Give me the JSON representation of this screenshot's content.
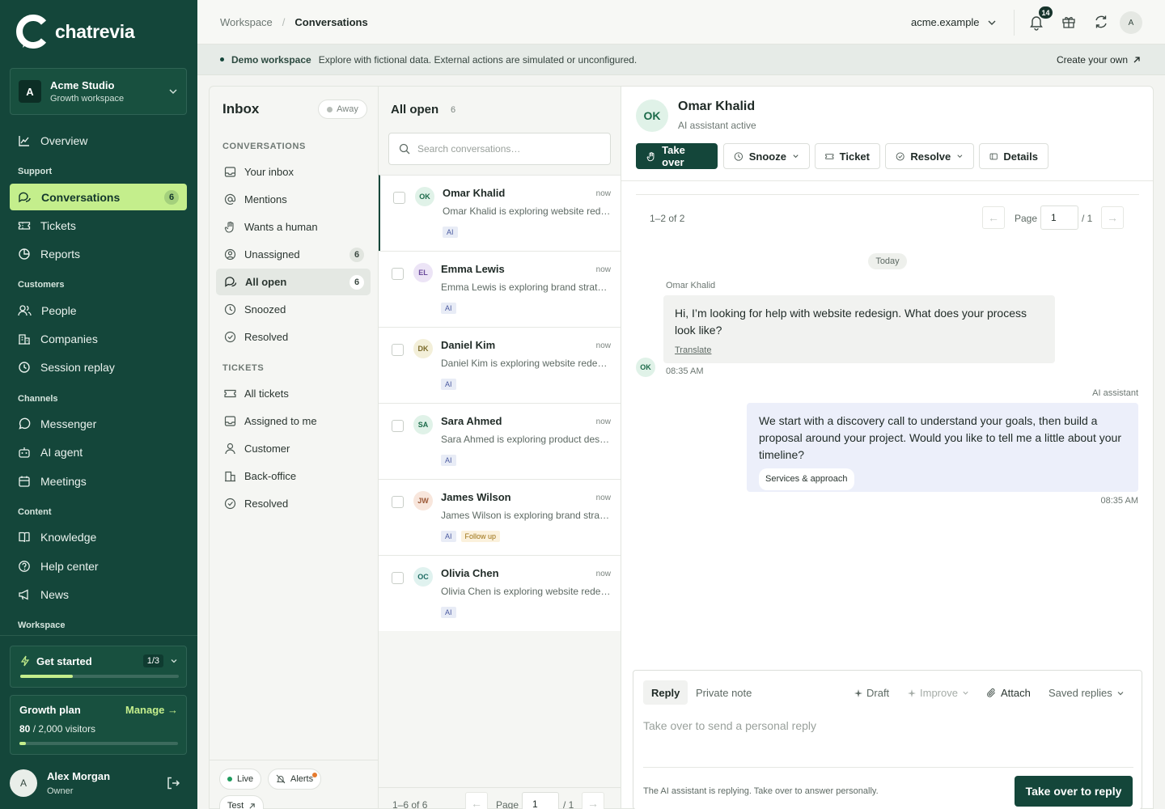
{
  "brand": {
    "name": "chatrevia"
  },
  "workspace": {
    "name": "Acme Studio",
    "plan": "Growth workspace",
    "initial": "A"
  },
  "nav": {
    "overview": "Overview",
    "sec_support": "Support",
    "conversations": "Conversations",
    "conversations_badge": "6",
    "tickets": "Tickets",
    "reports": "Reports",
    "sec_customers": "Customers",
    "people": "People",
    "companies": "Companies",
    "session_replay": "Session replay",
    "sec_channels": "Channels",
    "messenger": "Messenger",
    "ai_agent": "AI agent",
    "meetings": "Meetings",
    "sec_content": "Content",
    "knowledge": "Knowledge",
    "help_center": "Help center",
    "news": "News",
    "sec_workspace": "Workspace"
  },
  "get_started": {
    "label": "Get started",
    "count": "1/3",
    "progress": 0.33
  },
  "growth_plan": {
    "label": "Growth plan",
    "manage": "Manage →",
    "used": "80",
    "limit": " / 2,000 visitors",
    "progress": 0.04
  },
  "user": {
    "name": "Alex Morgan",
    "role": "Owner",
    "initial": "A"
  },
  "topbar": {
    "crumb_root": "Workspace",
    "crumb_sep": "/",
    "crumb_current": "Conversations",
    "domain": "acme.example",
    "notifications": "14",
    "avatar": "A"
  },
  "demo": {
    "tag": "Demo workspace",
    "text": "Explore with fictional data. External actions are simulated or unconfigured.",
    "link": "Create your own"
  },
  "inbox": {
    "title": "Inbox",
    "status": "Away",
    "sec_conversations": "CONVERSATIONS",
    "your_inbox": "Your inbox",
    "mentions": "Mentions",
    "wants_human": "Wants a human",
    "unassigned": "Unassigned",
    "unassigned_count": "6",
    "all_open": "All open",
    "all_open_count": "6",
    "snoozed": "Snoozed",
    "resolved": "Resolved",
    "sec_tickets": "TICKETS",
    "all_tickets": "All tickets",
    "assigned_to_me": "Assigned to me",
    "customer": "Customer",
    "back_office": "Back-office",
    "tickets_resolved": "Resolved",
    "live": "Live",
    "alerts": "Alerts",
    "test": "Test"
  },
  "list": {
    "title": "All open",
    "count": "6",
    "search_placeholder": "Search conversations…",
    "conversations": [
      {
        "initials": "OK",
        "name": "Omar Khalid",
        "time": "now",
        "preview": "Omar Khalid is exploring website redesign",
        "tags": [
          "AI"
        ],
        "avatar_bg": "#e0f2e8",
        "avatar_fg": "#1c6b4a"
      },
      {
        "initials": "EL",
        "name": "Emma Lewis",
        "time": "now",
        "preview": "Emma Lewis is exploring brand strategy",
        "tags": [
          "AI"
        ],
        "avatar_bg": "#ece4f6",
        "avatar_fg": "#6a4a9b"
      },
      {
        "initials": "DK",
        "name": "Daniel Kim",
        "time": "now",
        "preview": "Daniel Kim is exploring website redesign",
        "tags": [
          "AI"
        ],
        "avatar_bg": "#f3efd9",
        "avatar_fg": "#7a6a2a"
      },
      {
        "initials": "SA",
        "name": "Sara Ahmed",
        "time": "now",
        "preview": "Sara Ahmed is exploring product design",
        "tags": [
          "AI"
        ],
        "avatar_bg": "#e0f2e8",
        "avatar_fg": "#1c6b4a"
      },
      {
        "initials": "JW",
        "name": "James Wilson",
        "time": "now",
        "preview": "James Wilson is exploring brand strategy",
        "tags": [
          "AI",
          "Follow up"
        ],
        "avatar_bg": "#f8e6dc",
        "avatar_fg": "#9a5634"
      },
      {
        "initials": "OC",
        "name": "Olivia Chen",
        "time": "now",
        "preview": "Olivia Chen is exploring website redesign",
        "tags": [
          "AI"
        ],
        "avatar_bg": "#e0f2ef",
        "avatar_fg": "#1f6b63"
      }
    ],
    "range": "1–6 of 6",
    "page_label": "Page",
    "page": "1",
    "total": "/ 1"
  },
  "detail": {
    "initials": "OK",
    "name": "Omar Khalid",
    "status": "AI assistant active",
    "take_over": "Take over",
    "snooze": "Snooze",
    "ticket": "Ticket",
    "resolve": "Resolve",
    "details": "Details",
    "range": "1–2 of 2",
    "page_label": "Page",
    "page": "1",
    "total": "/ 1",
    "day": "Today",
    "in_author": "Omar Khalid",
    "in_text": "Hi, I’m looking for help with website redesign. What does your process look like?",
    "translate": "Translate",
    "in_time": "08:35 AM",
    "out_author": "AI assistant",
    "out_text": "We start with a discovery call to understand your goals, then build a proposal around your project. Would you like to tell me a little about your timeline?",
    "out_chip": "Services & approach",
    "out_time": "08:35 AM"
  },
  "composer": {
    "reply": "Reply",
    "private_note": "Private note",
    "draft": "Draft",
    "improve": "Improve",
    "attach": "Attach",
    "saved_replies": "Saved replies",
    "placeholder": "Take over to send a personal reply",
    "note": "The AI assistant is replying. Take over to answer personally.",
    "button": "Take over to reply"
  },
  "colors": {
    "brand": "#14463a",
    "accent": "#c4ee8c"
  }
}
